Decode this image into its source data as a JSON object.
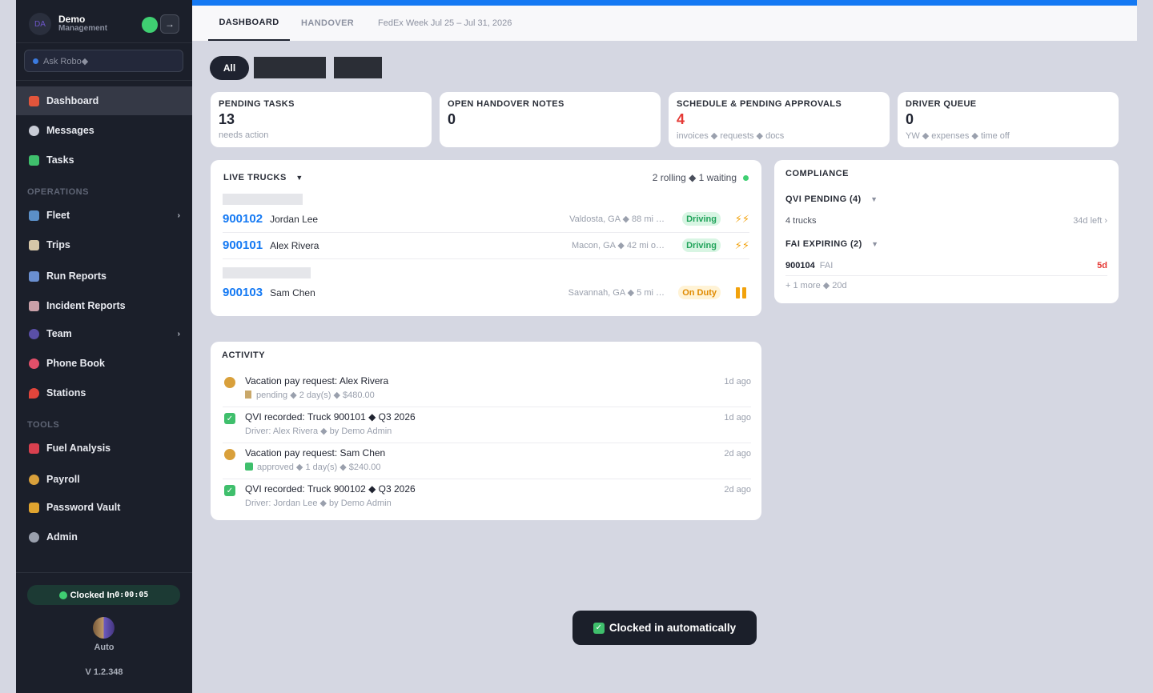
{
  "user": {
    "initials": "DA",
    "name": "Demo",
    "role": "Management"
  },
  "search": {
    "placeholder": "Ask Robo◆"
  },
  "nav": {
    "items": [
      {
        "label": "Dashboard"
      },
      {
        "label": "Messages"
      },
      {
        "label": "Tasks"
      }
    ],
    "operations_label": "OPERATIONS",
    "operations": [
      {
        "label": "Fleet"
      },
      {
        "label": "Trips"
      },
      {
        "label": "Run Reports"
      },
      {
        "label": "Incident Reports"
      },
      {
        "label": "Team"
      },
      {
        "label": "Phone Book"
      },
      {
        "label": "Stations"
      }
    ],
    "tools_label": "TOOLS",
    "tools": [
      {
        "label": "Fuel Analysis"
      },
      {
        "label": "Payroll"
      },
      {
        "label": "Password Vault"
      },
      {
        "label": "Admin"
      }
    ]
  },
  "clock": {
    "label": "Clocked In",
    "time": "0:00:05",
    "mode": "Auto"
  },
  "version": "V 1.2.348",
  "tabs": {
    "dashboard": "DASHBOARD",
    "handover": "HANDOVER",
    "week": "FedEx Week  Jul 25 – Jul 31, 2026"
  },
  "filter": {
    "all": "All"
  },
  "stats": [
    {
      "label": "PENDING TASKS",
      "value": "13",
      "sub": "needs action"
    },
    {
      "label": "OPEN HANDOVER NOTES",
      "value": "0",
      "sub": ""
    },
    {
      "label": "SCHEDULE & PENDING APPROVALS",
      "value": "4",
      "sub": "invoices ◆ requests ◆ docs"
    },
    {
      "label": "DRIVER QUEUE",
      "value": "0",
      "sub": "YW ◆ expenses ◆ time off"
    }
  ],
  "live_trucks": {
    "title": "LIVE TRUCKS",
    "summary": "2 rolling ◆ 1 waiting",
    "rows": [
      {
        "number": "900102",
        "driver": "Jordan Lee",
        "location": "Valdosta, GA ◆ 88 mi …",
        "status": "Driving",
        "icon": "⚡⚡"
      },
      {
        "number": "900101",
        "driver": "Alex Rivera",
        "location": "Macon, GA ◆ 42 mi o…",
        "status": "Driving",
        "icon": "⚡⚡"
      },
      {
        "number": "900103",
        "driver": "Sam Chen",
        "location": "Savannah, GA ◆ 5 mi …",
        "status": "On Duty"
      }
    ],
    "colors": {
      "rolling": "#3fcf72",
      "number": "#1479f3"
    }
  },
  "compliance": {
    "title": "COMPLIANCE",
    "qvi_header": "QVI PENDING (4)",
    "qvi_trucks": "4 trucks",
    "qvi_left": "34d left ›",
    "fai_header": "FAI EXPIRING (2)",
    "fai_truck": "900104",
    "fai_tag": "FAI",
    "fai_days": "5d",
    "more": "+ 1 more ◆ 20d"
  },
  "activity": {
    "title": "ACTIVITY",
    "rows": [
      {
        "title": "Vacation pay request: Alex Rivera",
        "sub": "pending ◆ 2 day(s) ◆ $480.00",
        "time": "1d ago",
        "icon": "money-bag-icon"
      },
      {
        "title": "QVI recorded: Truck 900101 ◆ Q3 2026",
        "sub": "Driver: Alex Rivera ◆ by Demo Admin",
        "time": "1d ago",
        "icon": "check-icon"
      },
      {
        "title": "Vacation pay request: Sam Chen",
        "sub": "approved ◆ 1 day(s) ◆ $240.00",
        "time": "2d ago",
        "icon": "money-bag-icon"
      },
      {
        "title": "QVI recorded: Truck 900102 ◆ Q3 2026",
        "sub": "Driver: Jordan Lee ◆ by Demo Admin",
        "time": "2d ago",
        "icon": "check-icon"
      }
    ]
  },
  "toast": {
    "message": "Clocked in automatically"
  }
}
